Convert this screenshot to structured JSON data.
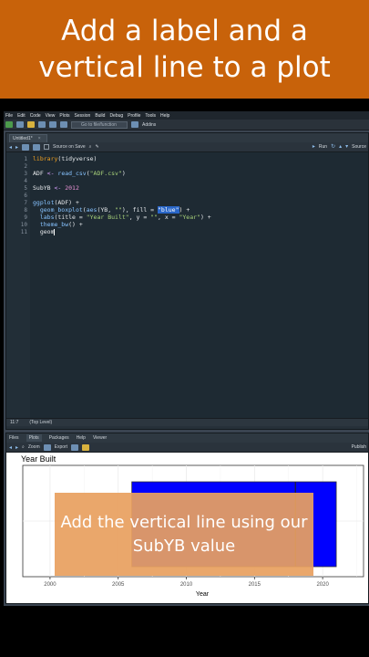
{
  "banner": {
    "title": "Add a label and a vertical line to a plot"
  },
  "menu": {
    "items": [
      "File",
      "Edit",
      "Code",
      "View",
      "Plots",
      "Session",
      "Build",
      "Debug",
      "Profile",
      "Tools",
      "Help"
    ]
  },
  "toolbar": {
    "goto_placeholder": "Go to file/function",
    "addins_label": "Addins"
  },
  "editor": {
    "tab_label": "Untitled1*",
    "source_on_save_label": "Source on Save",
    "run_label": "Run",
    "source_label": "Source",
    "status_position": "11:7",
    "status_scope": "(Top Level)",
    "line_numbers": [
      "1",
      "2",
      "3",
      "4",
      "5",
      "6",
      "7",
      "8",
      "9",
      "10",
      "11"
    ]
  },
  "plots_pane": {
    "tabs": [
      "Files",
      "Plots",
      "Packages",
      "Help",
      "Viewer"
    ],
    "active_tab": "Plots",
    "zoom_label": "Zoom",
    "export_label": "Export",
    "publish_label": "Publish"
  },
  "chart_data": {
    "type": "boxplot",
    "title": "Year Built",
    "xlabel": "Year",
    "ylabel": "",
    "x_ticks": [
      "2000",
      "2005",
      "2010",
      "2015",
      "2020"
    ],
    "xlim": [
      1998,
      2023
    ],
    "box": {
      "q1": 2006,
      "median": 2018,
      "q3": 2021,
      "fill": "#0000ff"
    },
    "grid": true,
    "theme": "bw"
  },
  "overlay": {
    "text": "Add the vertical line using our SubYB value"
  }
}
